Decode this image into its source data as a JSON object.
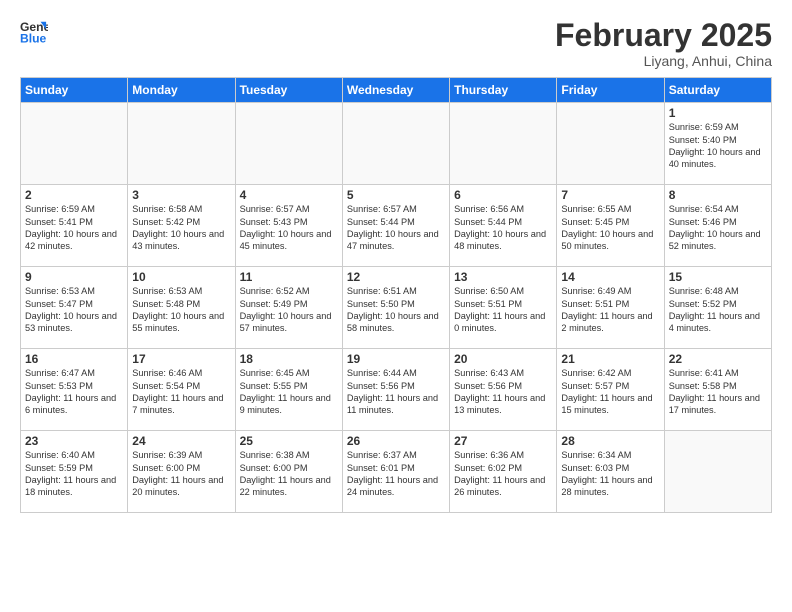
{
  "header": {
    "logo_general": "General",
    "logo_blue": "Blue",
    "month_title": "February 2025",
    "subtitle": "Liyang, Anhui, China"
  },
  "days_of_week": [
    "Sunday",
    "Monday",
    "Tuesday",
    "Wednesday",
    "Thursday",
    "Friday",
    "Saturday"
  ],
  "weeks": [
    [
      {
        "day": "",
        "info": ""
      },
      {
        "day": "",
        "info": ""
      },
      {
        "day": "",
        "info": ""
      },
      {
        "day": "",
        "info": ""
      },
      {
        "day": "",
        "info": ""
      },
      {
        "day": "",
        "info": ""
      },
      {
        "day": "1",
        "info": "Sunrise: 6:59 AM\nSunset: 5:40 PM\nDaylight: 10 hours and 40 minutes."
      }
    ],
    [
      {
        "day": "2",
        "info": "Sunrise: 6:59 AM\nSunset: 5:41 PM\nDaylight: 10 hours and 42 minutes."
      },
      {
        "day": "3",
        "info": "Sunrise: 6:58 AM\nSunset: 5:42 PM\nDaylight: 10 hours and 43 minutes."
      },
      {
        "day": "4",
        "info": "Sunrise: 6:57 AM\nSunset: 5:43 PM\nDaylight: 10 hours and 45 minutes."
      },
      {
        "day": "5",
        "info": "Sunrise: 6:57 AM\nSunset: 5:44 PM\nDaylight: 10 hours and 47 minutes."
      },
      {
        "day": "6",
        "info": "Sunrise: 6:56 AM\nSunset: 5:44 PM\nDaylight: 10 hours and 48 minutes."
      },
      {
        "day": "7",
        "info": "Sunrise: 6:55 AM\nSunset: 5:45 PM\nDaylight: 10 hours and 50 minutes."
      },
      {
        "day": "8",
        "info": "Sunrise: 6:54 AM\nSunset: 5:46 PM\nDaylight: 10 hours and 52 minutes."
      }
    ],
    [
      {
        "day": "9",
        "info": "Sunrise: 6:53 AM\nSunset: 5:47 PM\nDaylight: 10 hours and 53 minutes."
      },
      {
        "day": "10",
        "info": "Sunrise: 6:53 AM\nSunset: 5:48 PM\nDaylight: 10 hours and 55 minutes."
      },
      {
        "day": "11",
        "info": "Sunrise: 6:52 AM\nSunset: 5:49 PM\nDaylight: 10 hours and 57 minutes."
      },
      {
        "day": "12",
        "info": "Sunrise: 6:51 AM\nSunset: 5:50 PM\nDaylight: 10 hours and 58 minutes."
      },
      {
        "day": "13",
        "info": "Sunrise: 6:50 AM\nSunset: 5:51 PM\nDaylight: 11 hours and 0 minutes."
      },
      {
        "day": "14",
        "info": "Sunrise: 6:49 AM\nSunset: 5:51 PM\nDaylight: 11 hours and 2 minutes."
      },
      {
        "day": "15",
        "info": "Sunrise: 6:48 AM\nSunset: 5:52 PM\nDaylight: 11 hours and 4 minutes."
      }
    ],
    [
      {
        "day": "16",
        "info": "Sunrise: 6:47 AM\nSunset: 5:53 PM\nDaylight: 11 hours and 6 minutes."
      },
      {
        "day": "17",
        "info": "Sunrise: 6:46 AM\nSunset: 5:54 PM\nDaylight: 11 hours and 7 minutes."
      },
      {
        "day": "18",
        "info": "Sunrise: 6:45 AM\nSunset: 5:55 PM\nDaylight: 11 hours and 9 minutes."
      },
      {
        "day": "19",
        "info": "Sunrise: 6:44 AM\nSunset: 5:56 PM\nDaylight: 11 hours and 11 minutes."
      },
      {
        "day": "20",
        "info": "Sunrise: 6:43 AM\nSunset: 5:56 PM\nDaylight: 11 hours and 13 minutes."
      },
      {
        "day": "21",
        "info": "Sunrise: 6:42 AM\nSunset: 5:57 PM\nDaylight: 11 hours and 15 minutes."
      },
      {
        "day": "22",
        "info": "Sunrise: 6:41 AM\nSunset: 5:58 PM\nDaylight: 11 hours and 17 minutes."
      }
    ],
    [
      {
        "day": "23",
        "info": "Sunrise: 6:40 AM\nSunset: 5:59 PM\nDaylight: 11 hours and 18 minutes."
      },
      {
        "day": "24",
        "info": "Sunrise: 6:39 AM\nSunset: 6:00 PM\nDaylight: 11 hours and 20 minutes."
      },
      {
        "day": "25",
        "info": "Sunrise: 6:38 AM\nSunset: 6:00 PM\nDaylight: 11 hours and 22 minutes."
      },
      {
        "day": "26",
        "info": "Sunrise: 6:37 AM\nSunset: 6:01 PM\nDaylight: 11 hours and 24 minutes."
      },
      {
        "day": "27",
        "info": "Sunrise: 6:36 AM\nSunset: 6:02 PM\nDaylight: 11 hours and 26 minutes."
      },
      {
        "day": "28",
        "info": "Sunrise: 6:34 AM\nSunset: 6:03 PM\nDaylight: 11 hours and 28 minutes."
      },
      {
        "day": "",
        "info": ""
      }
    ]
  ]
}
